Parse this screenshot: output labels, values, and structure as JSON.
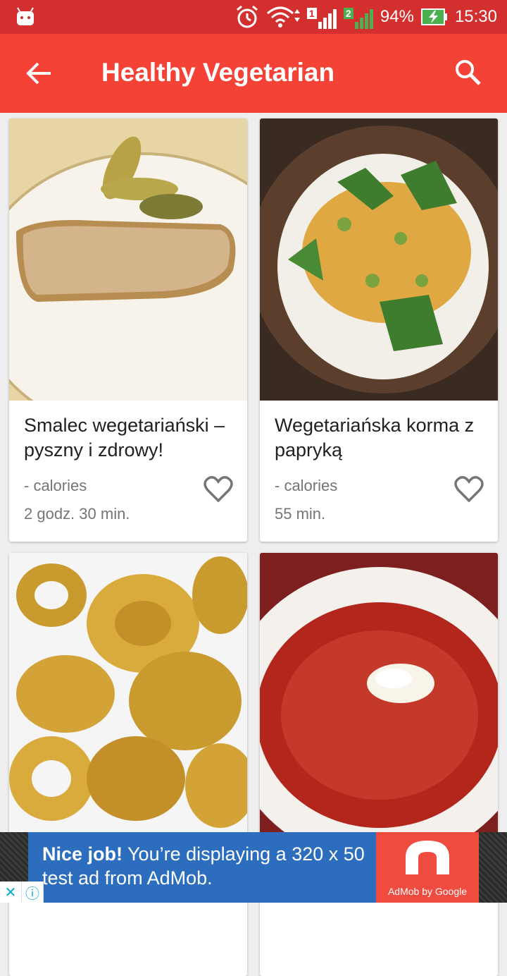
{
  "status_bar": {
    "battery": "94%",
    "time": "15:30",
    "sim1": "1",
    "sim2": "2",
    "icons": [
      "android-icon",
      "alarm-icon",
      "wifi-icon",
      "signal-icon",
      "battery-charging-icon"
    ]
  },
  "app_bar": {
    "title": "Healthy Vegetarian",
    "back_icon": "arrow-back-icon",
    "search_icon": "search-icon"
  },
  "recipes": [
    {
      "name": "Smalec wegetariański – pyszny i zdrowy!",
      "calories": "- calories",
      "time": "2 godz. 30 min."
    },
    {
      "name": "Wegetariańska korma z papryką",
      "calories": "- calories",
      "time": "55 min."
    },
    {
      "name": "",
      "calories": "",
      "time": ""
    },
    {
      "name": "",
      "calories": "",
      "time": ""
    }
  ],
  "ad": {
    "headline": "Nice job!",
    "text": "You’re displaying a 320 x 50 test ad from AdMob.",
    "brand": "AdMob by Google"
  },
  "colors": {
    "status_bar": "#d32f2f",
    "app_bar": "#f44336",
    "ad_background": "#2d6dbd",
    "ad_logo": "#ef4b3f"
  }
}
